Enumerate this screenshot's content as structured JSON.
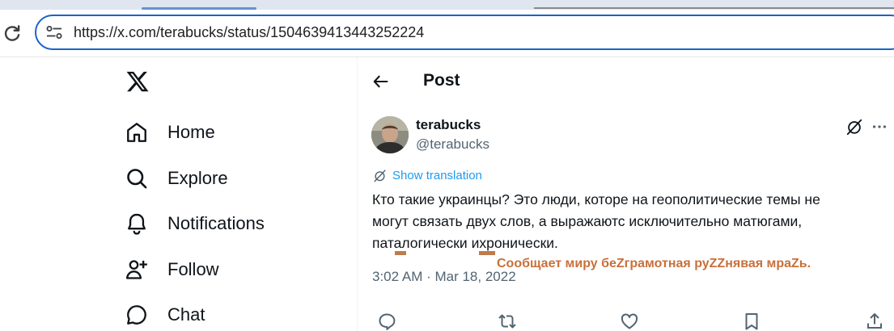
{
  "browser": {
    "url_full": "https://x.com/terabucks/status/1504639413443252224"
  },
  "nav": {
    "items": [
      {
        "label": "Home",
        "icon": "home-icon"
      },
      {
        "label": "Explore",
        "icon": "search-icon"
      },
      {
        "label": "Notifications",
        "icon": "bell-icon"
      },
      {
        "label": "Follow",
        "icon": "follow-icon"
      },
      {
        "label": "Chat",
        "icon": "chat-icon"
      }
    ]
  },
  "post": {
    "header_title": "Post",
    "author": {
      "display_name": "terabucks",
      "handle": "@terabucks"
    },
    "show_translation": "Show translation",
    "text_lines": [
      "Кто такие украинцы? Это люди, которе на геополитические темы не",
      "могут связать двух слов, а выражаютс исключительно матюгами,",
      "паталогически ихронически."
    ],
    "timestamp": "3:02 AM · Mar 18, 2022",
    "actions": [
      "reply-icon",
      "repost-icon",
      "like-icon",
      "bookmark-icon",
      "share-icon"
    ]
  },
  "annotation": {
    "text": "Сообщает миру беZграмотная руZZнявая мраZь.",
    "color": "#c8703a"
  },
  "colors": {
    "accent": "#1d9bf0",
    "address_border": "#1a63c7",
    "secondary_text": "#536471"
  }
}
